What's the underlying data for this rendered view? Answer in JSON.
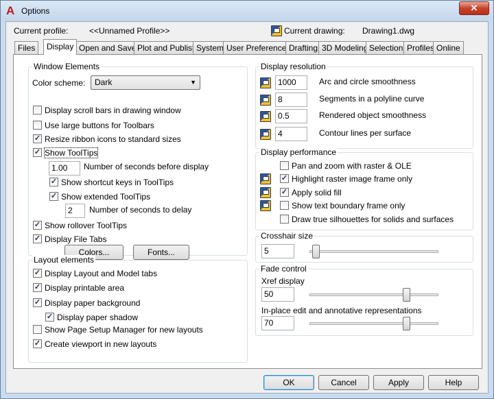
{
  "window": {
    "title": "Options",
    "close_symbol": "✕"
  },
  "profile": {
    "label": "Current profile:",
    "value": "<<Unnamed Profile>>"
  },
  "drawing": {
    "label": "Current drawing:",
    "value": "Drawing1.dwg"
  },
  "tabs": [
    {
      "label": "Files"
    },
    {
      "label": "Display",
      "active": true
    },
    {
      "label": "Open and Save"
    },
    {
      "label": "Plot and Publish"
    },
    {
      "label": "System"
    },
    {
      "label": "User Preferences"
    },
    {
      "label": "Drafting"
    },
    {
      "label": "3D Modeling"
    },
    {
      "label": "Selection"
    },
    {
      "label": "Profiles"
    },
    {
      "label": "Online"
    }
  ],
  "window_elements": {
    "title": "Window Elements",
    "color_scheme_label": "Color scheme:",
    "color_scheme_value": "Dark",
    "options": [
      {
        "label": "Display scroll bars in drawing window",
        "checked": false
      },
      {
        "label": "Use large buttons for Toolbars",
        "checked": false
      },
      {
        "label": "Resize ribbon icons to standard sizes",
        "checked": true
      },
      {
        "label": "Show ToolTips",
        "checked": true
      },
      {
        "label": "Show shortcut keys in ToolTips",
        "checked": true
      },
      {
        "label": "Show extended ToolTips",
        "checked": true
      },
      {
        "label": "Show rollover ToolTips",
        "checked": true
      },
      {
        "label": "Display File Tabs",
        "checked": true
      }
    ],
    "tooltip_delay_value": "1.00",
    "tooltip_delay_label": "Number of seconds before display",
    "extended_delay_value": "2",
    "extended_delay_label": "Number of seconds to delay",
    "colors_button": "Colors...",
    "fonts_button": "Fonts..."
  },
  "layout_elements": {
    "title": "Layout elements",
    "options": [
      {
        "label": "Display Layout and Model tabs",
        "checked": true
      },
      {
        "label": "Display printable area",
        "checked": true
      },
      {
        "label": "Display paper background",
        "checked": true
      },
      {
        "label": "Display paper shadow",
        "checked": true
      },
      {
        "label": "Show Page Setup Manager for new layouts",
        "checked": false
      },
      {
        "label": "Create viewport in new layouts",
        "checked": true
      }
    ]
  },
  "display_resolution": {
    "title": "Display resolution",
    "items": [
      {
        "value": "1000",
        "label": "Arc and circle smoothness"
      },
      {
        "value": "8",
        "label": "Segments in a polyline curve"
      },
      {
        "value": "0.5",
        "label": "Rendered object smoothness"
      },
      {
        "value": "4",
        "label": "Contour lines per surface"
      }
    ]
  },
  "display_performance": {
    "title": "Display performance",
    "options": [
      {
        "label": "Pan and zoom with raster & OLE",
        "checked": false,
        "icon": false
      },
      {
        "label": "Highlight raster image frame only",
        "checked": true,
        "icon": true
      },
      {
        "label": "Apply solid fill",
        "checked": true,
        "icon": true
      },
      {
        "label": "Show text boundary frame only",
        "checked": false,
        "icon": true
      },
      {
        "label": "Draw true silhouettes for solids and surfaces",
        "checked": false,
        "icon": false
      }
    ]
  },
  "crosshair": {
    "title": "Crosshair size",
    "value": "5",
    "level": 0.05
  },
  "fade": {
    "title": "Fade control",
    "xref_label": "Xref display",
    "xref_value": "50",
    "xref_level": 0.75,
    "inplace_label": "In-place edit and annotative representations",
    "inplace_value": "70",
    "inplace_level": 0.75
  },
  "footer": {
    "ok": "OK",
    "cancel": "Cancel",
    "apply": "Apply",
    "help": "Help"
  },
  "check_mark": "✓",
  "colors": {
    "title_bg": "#c9dbef",
    "close_red": "#c7432b",
    "logo_red": "#c41919",
    "default_btn": "#3c7fb1"
  }
}
